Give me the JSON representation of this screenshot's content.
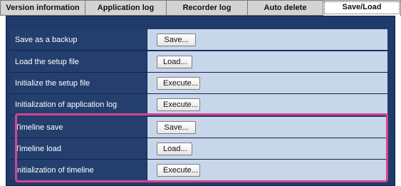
{
  "tabs": [
    {
      "label": "Version information"
    },
    {
      "label": "Application log"
    },
    {
      "label": "Recorder log"
    },
    {
      "label": "Auto delete"
    },
    {
      "label": "Save/Load"
    }
  ],
  "rows": [
    {
      "label": "Save as a backup",
      "button": "Save..."
    },
    {
      "label": "Load the setup file",
      "button": "Load..."
    },
    {
      "label": "Initialize the setup file",
      "button": "Execute..."
    },
    {
      "label": "Initialization of application log",
      "button": "Execute..."
    },
    {
      "label": "Timeline save",
      "button": "Save..."
    },
    {
      "label": "Timeline load",
      "button": "Load..."
    },
    {
      "label": "Initialization of timeline",
      "button": "Execute..."
    }
  ],
  "colors": {
    "panel_bg": "#1f3a6b",
    "label_bg": "#243f6e",
    "cell_bg": "#c8d6ea",
    "highlight_border": "#d3448c"
  }
}
